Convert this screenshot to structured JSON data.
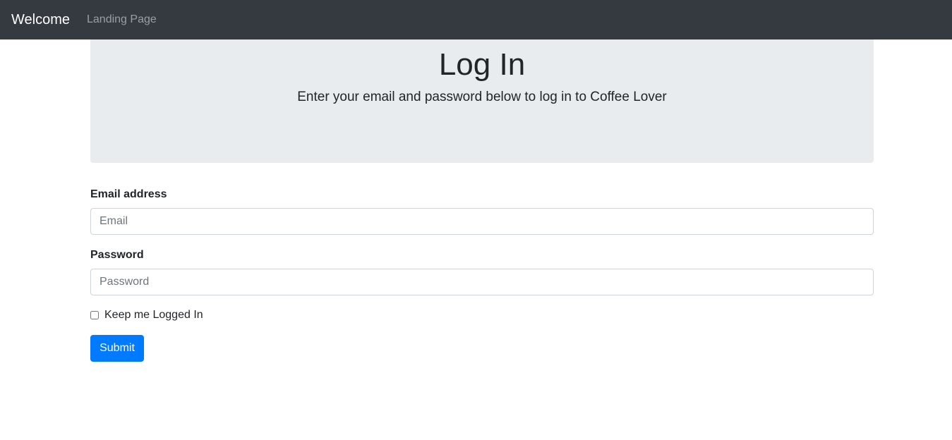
{
  "navbar": {
    "brand": "Welcome",
    "links": [
      {
        "label": "Landing Page"
      }
    ]
  },
  "jumbotron": {
    "title": "Log In",
    "lead": "Enter your email and password below to log in to Coffee Lover"
  },
  "form": {
    "email": {
      "label": "Email address",
      "placeholder": "Email",
      "value": ""
    },
    "password": {
      "label": "Password",
      "placeholder": "Password",
      "value": ""
    },
    "remember": {
      "label": "Keep me Logged In",
      "checked": false
    },
    "submit_label": "Submit"
  },
  "colors": {
    "navbar_bg": "#343a40",
    "jumbotron_bg": "#e9ecef",
    "primary": "#007bff"
  }
}
